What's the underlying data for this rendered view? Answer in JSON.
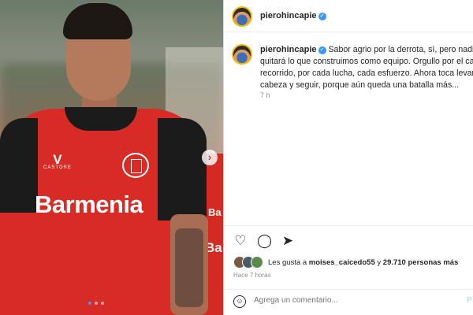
{
  "photo": {
    "jersey_brand": "Barmenia",
    "kit_maker_mark": "V",
    "kit_maker_word": "CASTORE",
    "other_player_text_1": "Ba",
    "other_player_text_2": "Ba",
    "next_icon": "chevron-right-icon",
    "carousel_total": 3,
    "carousel_active": 1
  },
  "post": {
    "username": "piero hincapie",
    "handle": "pierohincapie",
    "verified_badge": "✓",
    "caption": "Sabor agrio por la derrota, sí, pero nadie no quitará lo que construimos como equipo. Orgullo por el camino recorrido, por cada lucha, cada esfuerzo. Ahora toca levantar la cabeza y seguir, porque aún queda una batalla más...",
    "relative_time": "7 h",
    "likes_prefix": "Les gusta a ",
    "likes_user": "moises_caicedo55",
    "likes_middle": " y ",
    "likes_count": "29.710 personas más",
    "posted_ago": "Hace 7 horas",
    "comment_placeholder": "Agrega un comentario...",
    "post_button": "P"
  },
  "colors": {
    "accent": "#3897f0",
    "jersey_red": "#d92b25",
    "muted_text": "#8e8e8e"
  }
}
